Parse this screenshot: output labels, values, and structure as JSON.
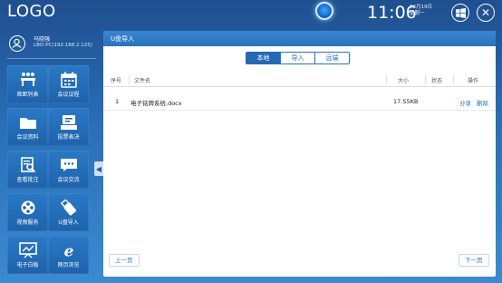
{
  "topbar": {
    "logo": "LOGO",
    "time": "11:06",
    "date_line1": "03月19日",
    "date_line2": "星期一"
  },
  "user": {
    "name": "马晓强",
    "host": "LBO-PC(192.168.2.125)"
  },
  "tiles": [
    {
      "label": "席距列表",
      "icon": "people-list-icon"
    },
    {
      "label": "会议议程",
      "icon": "calendar-icon"
    },
    {
      "label": "会议资料",
      "icon": "folder-icon"
    },
    {
      "label": "投票表决",
      "icon": "vote-icon"
    },
    {
      "label": "查看批注",
      "icon": "annotation-view-icon"
    },
    {
      "label": "会议交流",
      "icon": "chat-icon"
    },
    {
      "label": "视频服务",
      "icon": "film-reel-icon"
    },
    {
      "label": "U盘导入",
      "icon": "usb-import-icon"
    },
    {
      "label": "电子白板",
      "icon": "whiteboard-icon"
    },
    {
      "label": "网页浏览",
      "icon": "browser-icon"
    }
  ],
  "panel": {
    "title": "U盘导入",
    "tabs": [
      "本地",
      "导入",
      "远端"
    ],
    "active_tab": "本地",
    "columns": {
      "index": "序号",
      "filename": "文件名",
      "size": "大小",
      "status": "状态",
      "action": "操作"
    },
    "rows": [
      {
        "index": "1",
        "filename": "电子铭牌系统.docx",
        "size": "17.55KB",
        "status": "",
        "share": "分享",
        "delete": "删除"
      }
    ],
    "prev_page": "上一页",
    "next_page": "下一页"
  },
  "colors": {
    "accent": "#2a72bf",
    "tile": "#1e62ab",
    "background": "#2a6fb8"
  }
}
